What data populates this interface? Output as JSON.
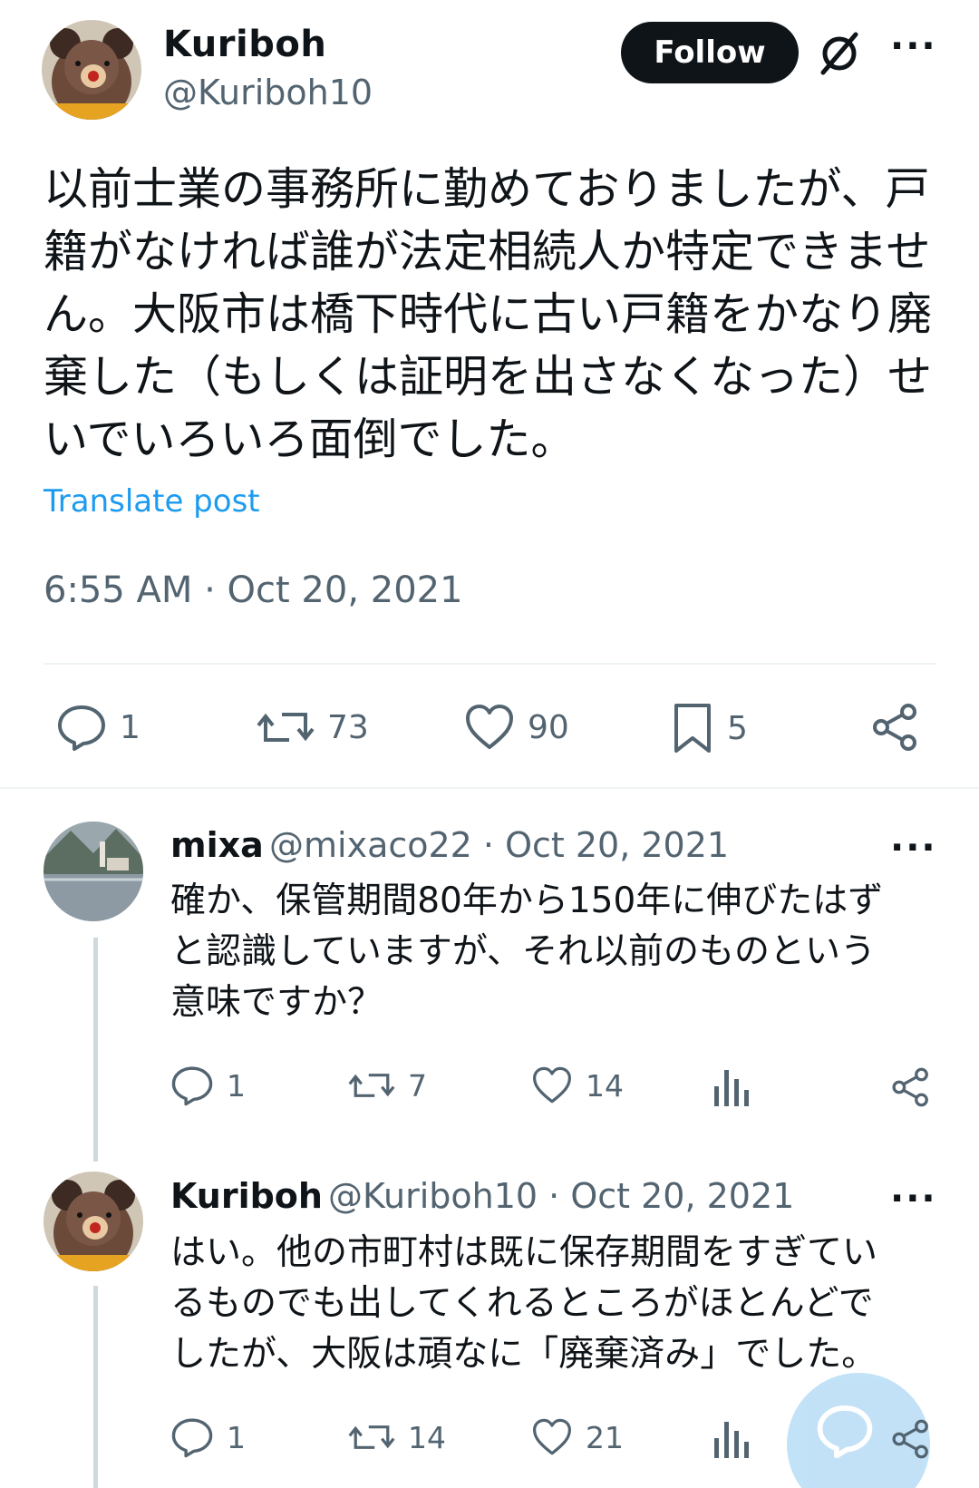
{
  "post": {
    "author": {
      "name": "Kuriboh",
      "handle": "@Kuriboh10"
    },
    "follow_label": "Follow",
    "text_lines": [
      "以前士業の事務所に勤めておりましたが、戸",
      "籍がなければ誰が法定相続人か特定できませ",
      "ん。大阪市は橋下時代に古い戸籍をかなり廃",
      "棄した（もしくは証明を出さなくなった）せ",
      "いでいろいろ面倒でした。"
    ],
    "translate_label": "Translate post",
    "timestamp": "6:55 AM · Oct 20, 2021",
    "stats": {
      "replies": "1",
      "reposts": "73",
      "likes": "90",
      "bookmarks": "5"
    }
  },
  "replies": [
    {
      "name": "mixa",
      "meta": "@mixaco22 · Oct 20, 2021",
      "text_lines": [
        "確か、保管期間80年から150年に伸びたはず",
        "と認識していますが、それ以前のものという",
        "意味ですか？"
      ],
      "stats": {
        "replies": "1",
        "reposts": "7",
        "likes": "14"
      }
    },
    {
      "name": "Kuriboh",
      "meta": "@Kuriboh10 · Oct 20, 2021",
      "text_lines": [
        "はい。他の市町村は既に保存期間をすぎてい",
        "るものでも出してくれるところがほとんどで",
        "したが、大阪は頑なに「廃棄済み」でした。"
      ],
      "stats": {
        "replies": "1",
        "reposts": "14",
        "likes": "21"
      }
    }
  ],
  "more_label": "···",
  "colors": {
    "text": "#0f1419",
    "secondary": "#536471",
    "accent": "#1d9bf0",
    "divider": "#eff3f4"
  },
  "icons": [
    "grok-icon",
    "more-icon",
    "reply-icon",
    "repost-icon",
    "like-icon",
    "bookmark-icon",
    "share-icon",
    "views-icon",
    "compose-icon"
  ]
}
